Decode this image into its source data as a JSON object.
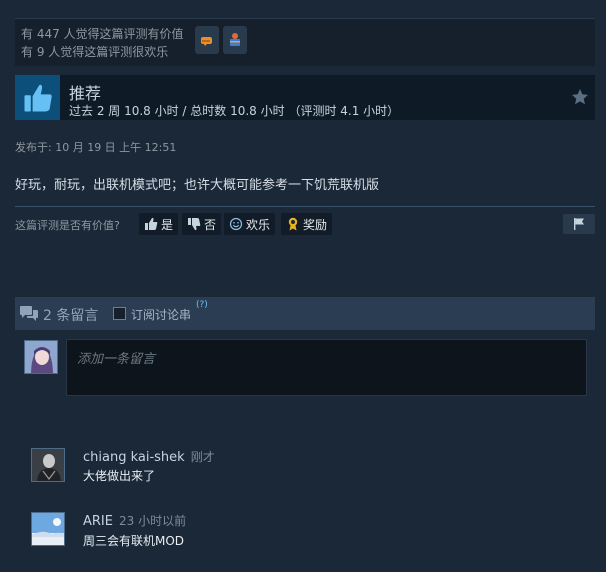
{
  "stats": {
    "helpful_line": "有 447 人觉得这篇评测有价值",
    "funny_line": "有 9 人觉得这篇评测很欢乐",
    "award_icons": [
      "glove-award-icon",
      "treasure-chest-award-icon"
    ]
  },
  "recommendation": {
    "title": "推荐",
    "hours": "过去 2 周 10.8 小时 / 总时数 10.8 小时 （评测时 4.1 小时）",
    "thumb_icon": "thumbs-up-icon"
  },
  "posted": "发布于: 10 月 19 日 上午 12:51",
  "review_text": "好玩，耐玩，出联机模式吧；也许大概可能参考一下饥荒联机版",
  "vote": {
    "question": "这篇评测是否有价值?",
    "yes": "是",
    "no": "否",
    "funny": "欢乐",
    "award": "奖励"
  },
  "comments_section": {
    "count_label": "2 条留言",
    "subscribe_label": "订阅讨论串",
    "help": "(?)",
    "input_placeholder": "添加一条留言"
  },
  "comments": [
    {
      "author": "chiang kai-shek",
      "time": "刚才",
      "text": "大佬做出来了"
    },
    {
      "author": "ARIE",
      "time": "23 小时以前",
      "text": "周三会有联机MOD"
    }
  ],
  "colors": {
    "background": "#1b2838",
    "accent_link": "#67c1f5",
    "recommend_blue": "#0c4f7a"
  }
}
